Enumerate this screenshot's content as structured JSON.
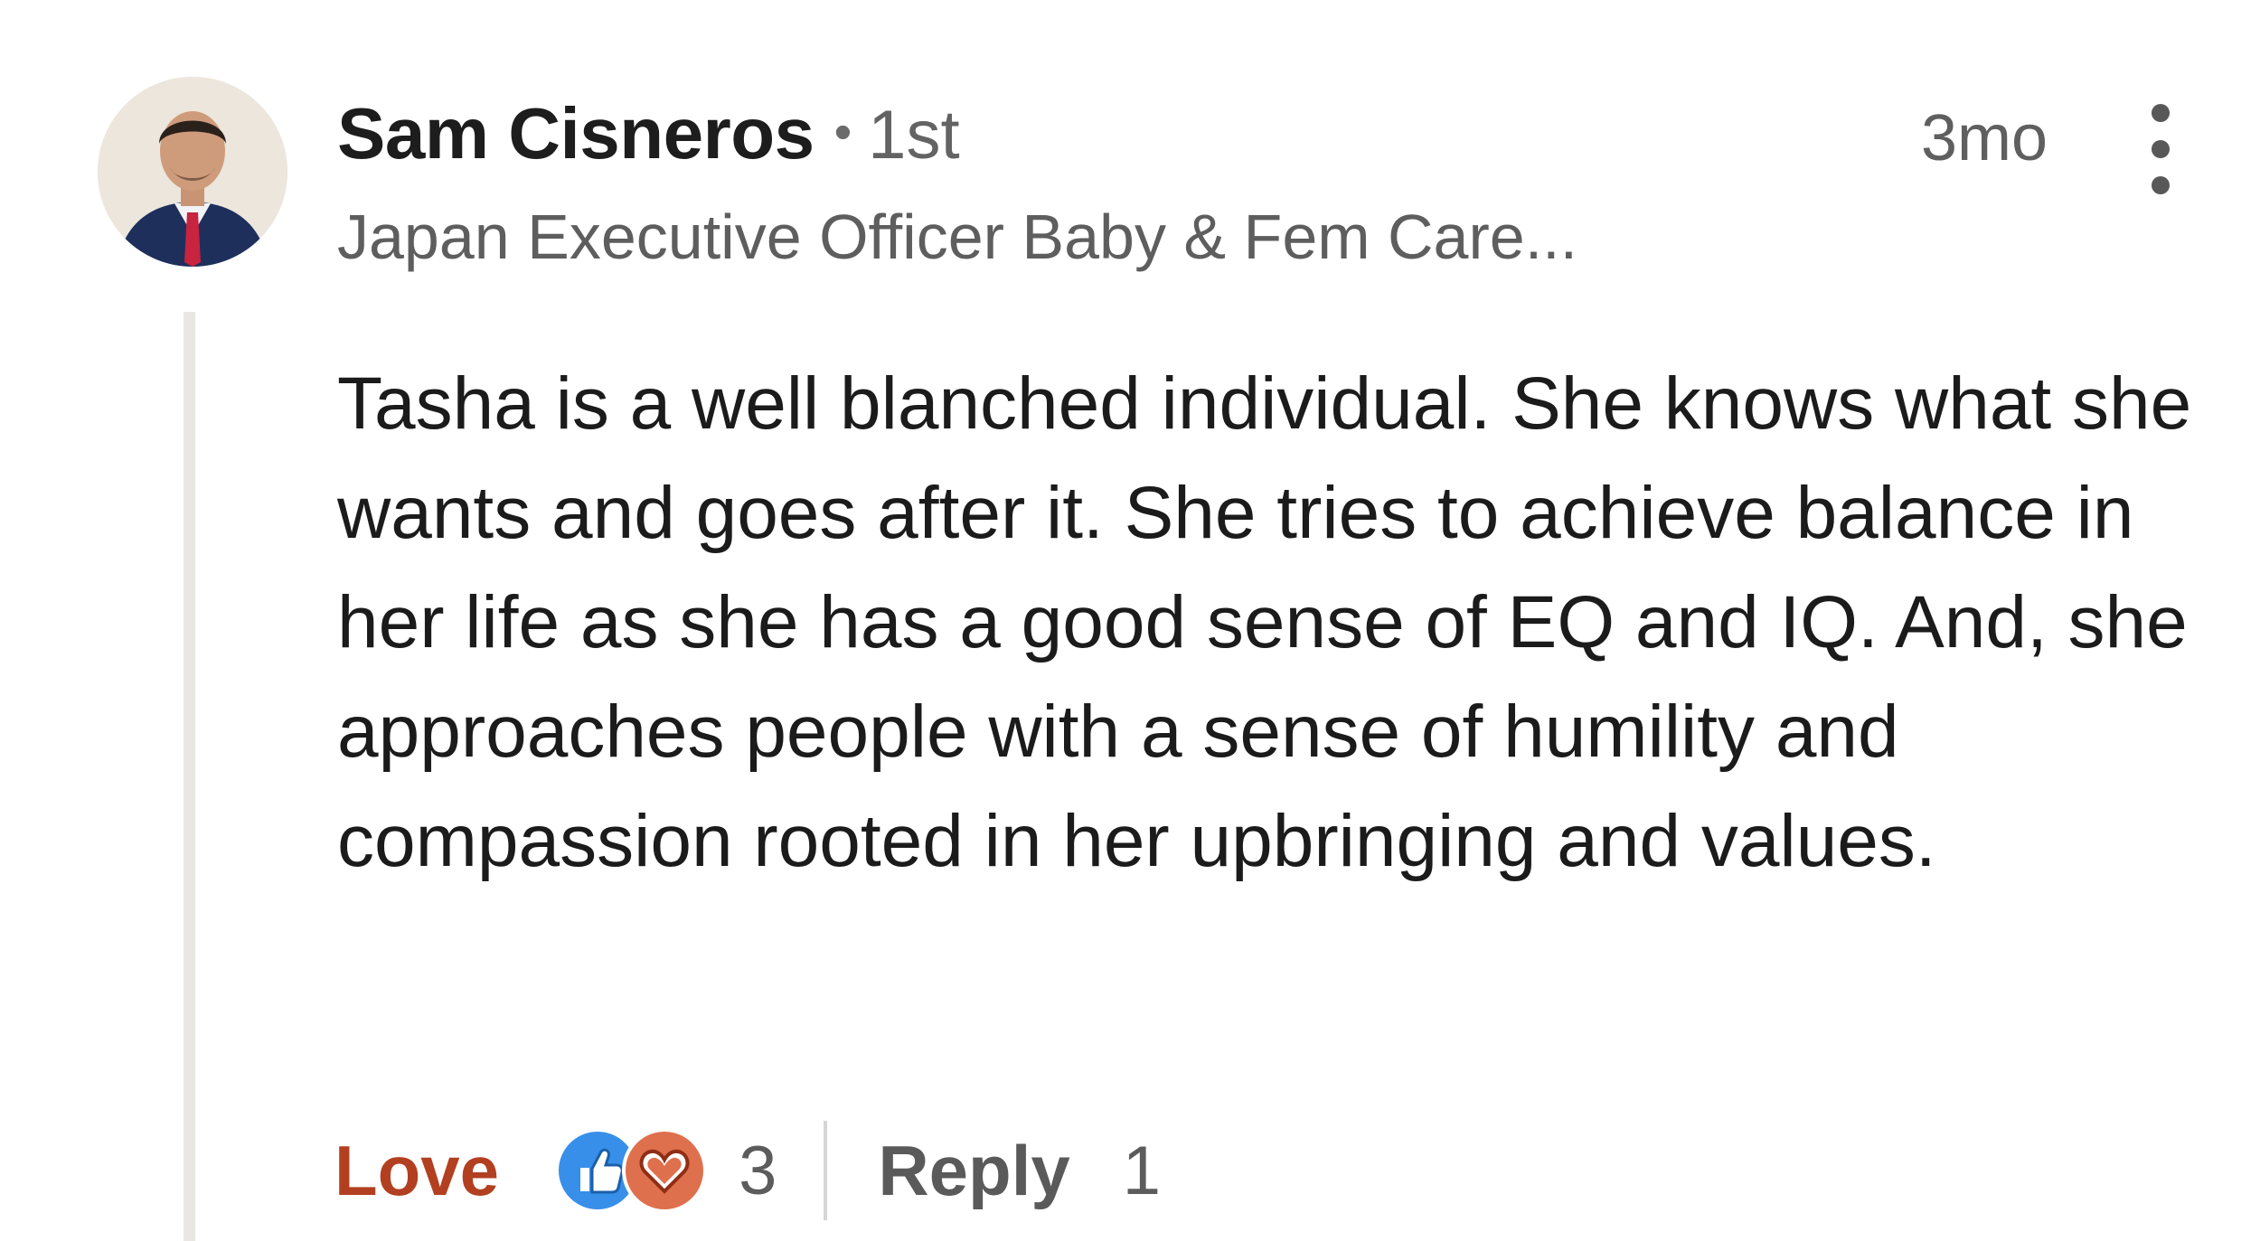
{
  "comment": {
    "author": {
      "name": "Sam Cisneros",
      "separator": "•",
      "connection_degree": "1st",
      "headline": "Japan Executive Officer Baby & Fem Care..."
    },
    "timestamp": "3mo",
    "more_options_icon": "vertical-ellipsis-icon",
    "body": "Tasha is a well blanched individual. She knows what she wants and goes after it. She tries to achieve balance in her life as she has a good sense of EQ and IQ. And, she approaches people with a sense of humility and compassion rooted in her upbringing and values."
  },
  "actions": {
    "reaction_label": "Love",
    "reaction_icons": [
      "like-icon",
      "heart-icon"
    ],
    "reaction_count": "3",
    "reply_label": "Reply",
    "reply_count": "1"
  },
  "colors": {
    "love_accent": "#b24020",
    "like_blue": "#378fe9",
    "heart_orange": "#df704d",
    "thread_line": "#e9e7e3"
  }
}
